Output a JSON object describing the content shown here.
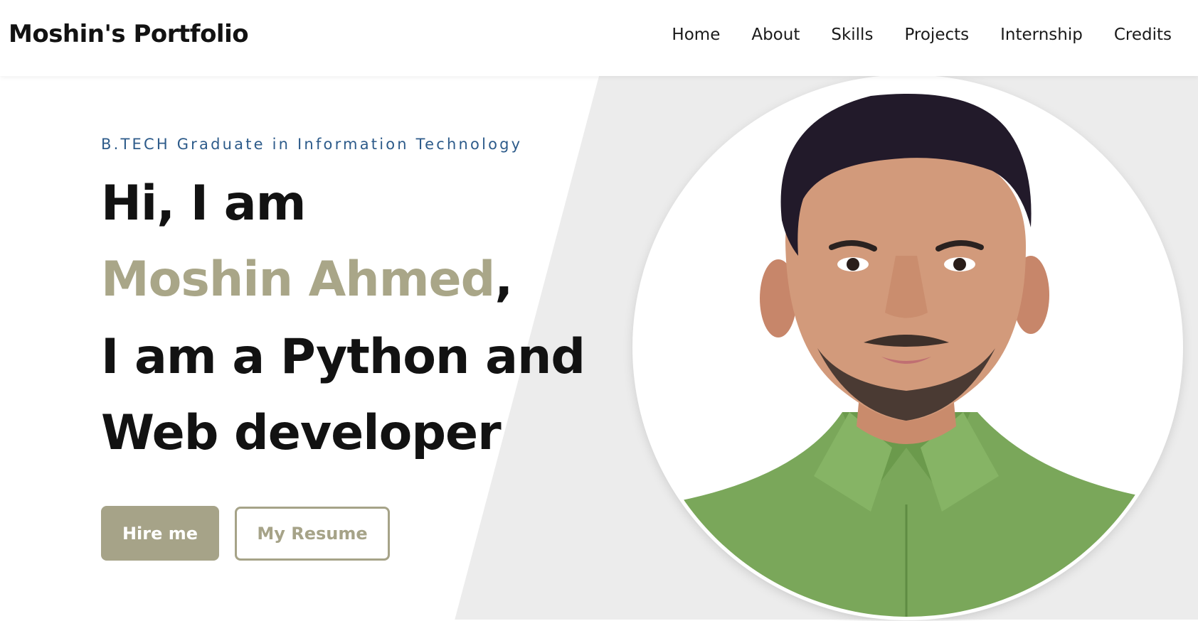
{
  "brand": {
    "title": "Moshin's Portfolio"
  },
  "nav": {
    "items": [
      {
        "label": "Home"
      },
      {
        "label": "About"
      },
      {
        "label": "Skills"
      },
      {
        "label": "Projects"
      },
      {
        "label": "Internship"
      },
      {
        "label": "Credits"
      }
    ]
  },
  "hero": {
    "eyebrow": "B.TECH Graduate in Information Technology",
    "greeting": "Hi, I am",
    "name": "Moshin Ahmed",
    "name_suffix": ",",
    "role_line1": "I am a Python and",
    "role_line2": "Web developer",
    "hire_label": "Hire me",
    "resume_label": "My Resume",
    "photo_alt": "Profile photo"
  },
  "colors": {
    "accent": "#a6a388",
    "text": "#121212",
    "eyebrow": "#2d5b8a",
    "hero_bg": "#ececec"
  }
}
